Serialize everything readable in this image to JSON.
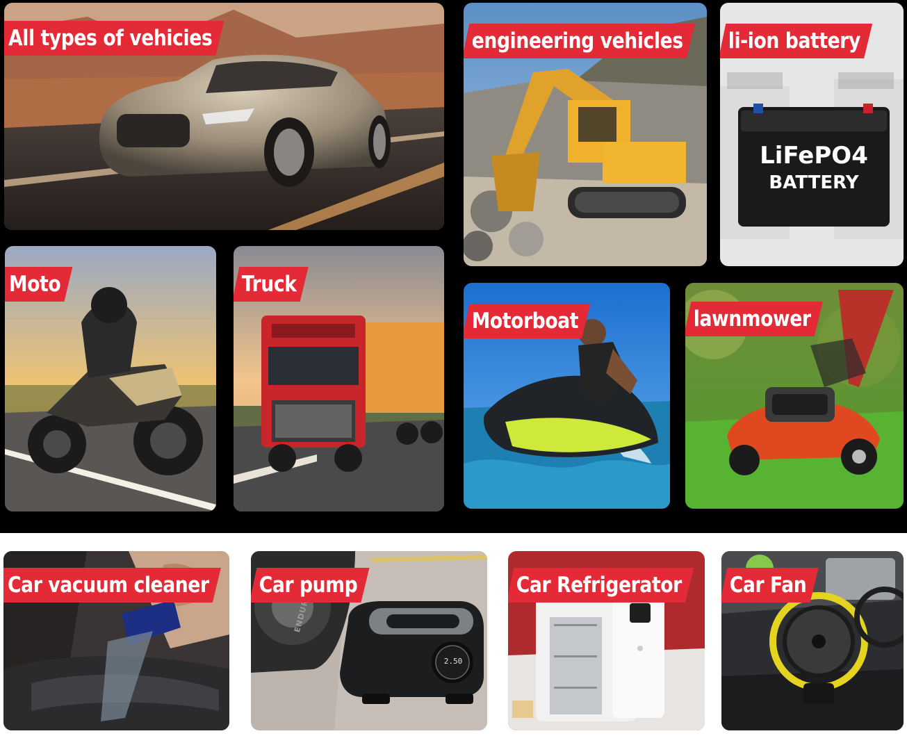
{
  "tiles": {
    "all_vehicles": {
      "label": "All types of vehicies"
    },
    "engineering": {
      "label": "engineering vehicles"
    },
    "battery": {
      "label": "li-ion battery",
      "badge_line1": "LiFePO4",
      "badge_line2": "BATTERY"
    },
    "moto": {
      "label": "Moto"
    },
    "truck": {
      "label": "Truck"
    },
    "motorboat": {
      "label": "Motorboat"
    },
    "lawnmower": {
      "label": "lawnmower"
    },
    "vacuum": {
      "label": "Car vacuum cleaner"
    },
    "pump": {
      "label": "Car pump",
      "display": "2.50",
      "tire_text": "ENDURANCE"
    },
    "fridge": {
      "label": "Car Refrigerator"
    },
    "fan": {
      "label": "Car Fan"
    }
  },
  "colors": {
    "tag_red": "#e32a36",
    "background": "#000000",
    "band": "#ffffff"
  }
}
